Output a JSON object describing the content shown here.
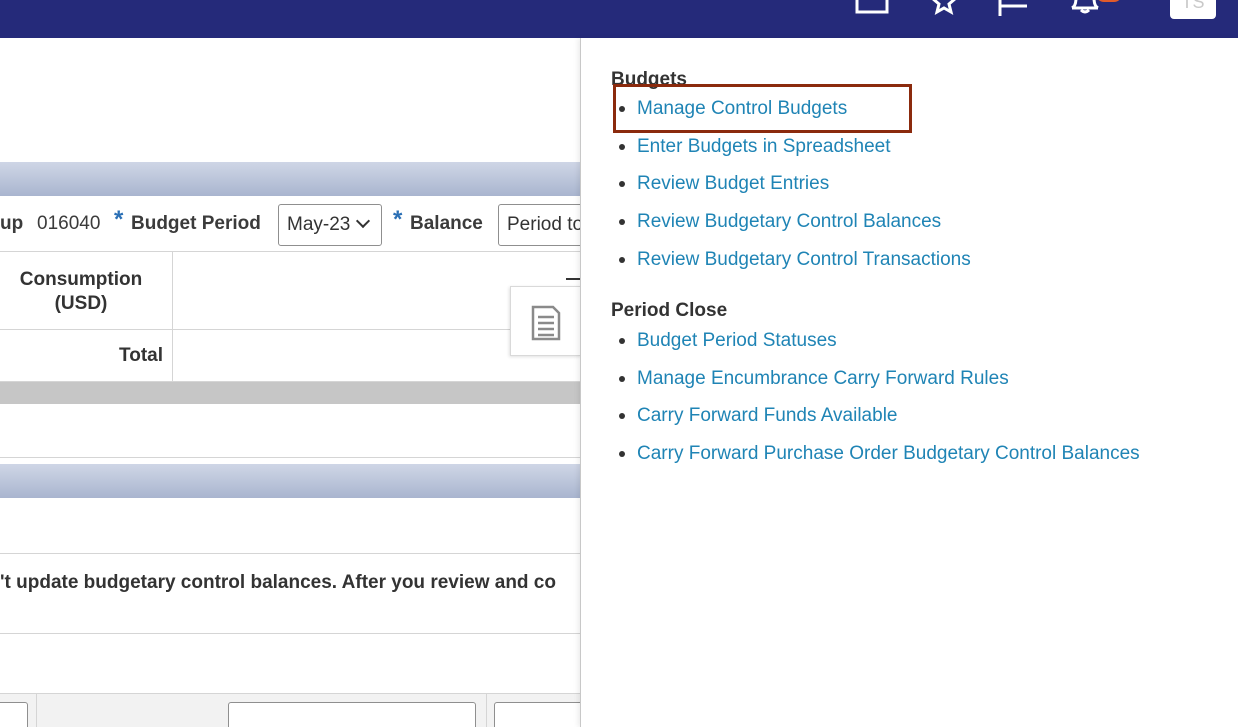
{
  "header": {
    "user_initials": "TS",
    "icons": [
      "home-icon",
      "favorites-star-icon",
      "flag-icon",
      "notifications-bell-icon"
    ],
    "colors": {
      "bar": "#252a7a",
      "badge": "#e05b2b"
    }
  },
  "page": {
    "params": {
      "group_label": "up",
      "group_value": "016040",
      "required_marker": "*",
      "budget_period_label": "Budget Period",
      "budget_period_value": "May-23",
      "balance_label": "Balance",
      "balance_value": "Period to"
    },
    "table": {
      "consumption_header": "Consumption (USD)",
      "total_label": "Total"
    },
    "message": "'t update budgetary control balances. After you review and co"
  },
  "panel": {
    "groups": [
      {
        "title": "Budgets",
        "items": [
          "Manage Control Budgets",
          "Enter Budgets in Spreadsheet",
          "Review Budget Entries",
          "Review Budgetary Control Balances",
          "Review Budgetary Control Transactions"
        ]
      },
      {
        "title": "Period Close",
        "items": [
          "Budget Period Statuses",
          "Manage Encumbrance Carry Forward Rules",
          "Carry Forward Funds Available",
          "Carry Forward Purchase Order Budgetary Control Balances"
        ]
      }
    ],
    "highlight_color": "#8b2a0d",
    "link_color": "#1f84b5"
  }
}
